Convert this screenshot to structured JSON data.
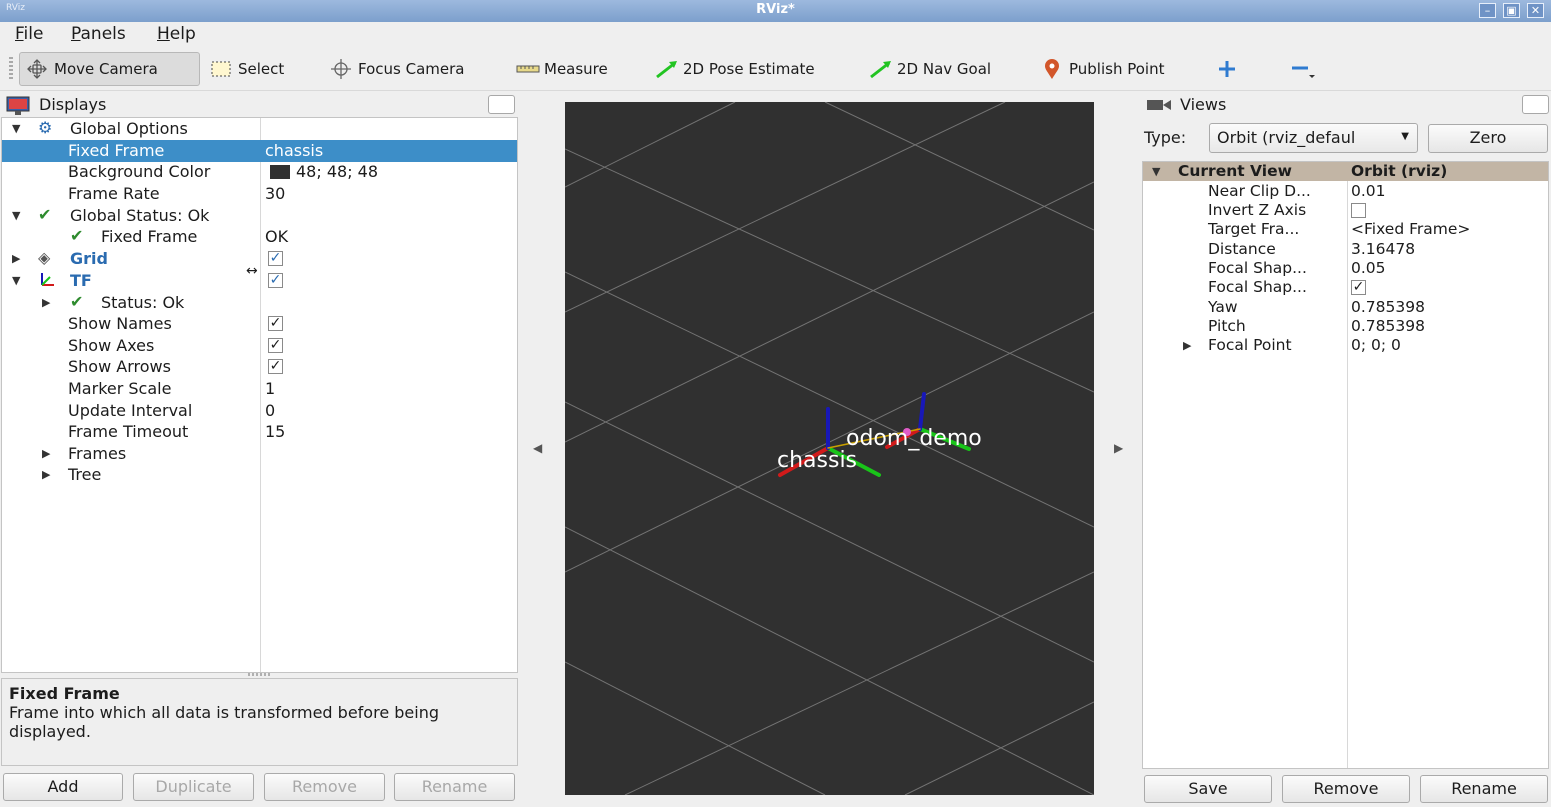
{
  "window": {
    "title": "RViz*",
    "app_icon": "RViz",
    "buttons": [
      "minimize-icon",
      "maximize-icon",
      "close-icon"
    ]
  },
  "menu": {
    "file": "File",
    "panels": "Panels",
    "help": "Help"
  },
  "toolbar": {
    "move_camera": "Move Camera",
    "select": "Select",
    "focus_camera": "Focus Camera",
    "measure": "Measure",
    "pose_estimate": "2D Pose Estimate",
    "nav_goal": "2D Nav Goal",
    "publish_point": "Publish Point",
    "add_tool_icon": "plus-icon",
    "remove_tool_icon": "minus-icon",
    "colors": {
      "nav_arrow": "#22c422",
      "publish_pin": "#d2562a",
      "plus": "#2f7bd0"
    }
  },
  "displays": {
    "title": "Displays",
    "rows": {
      "global_options": "Global Options",
      "fixed_frame_label": "Fixed Frame",
      "fixed_frame_value": "chassis",
      "background_color_label": "Background Color",
      "background_color_value": "48; 48; 48",
      "frame_rate_label": "Frame Rate",
      "frame_rate_value": "30",
      "global_status": "Global Status: Ok",
      "gs_fixed_frame": "Fixed Frame",
      "gs_fixed_frame_value": "OK",
      "grid": "Grid",
      "tf": "TF",
      "tf_status": "Status: Ok",
      "show_names": "Show Names",
      "show_axes": "Show Axes",
      "show_arrows": "Show Arrows",
      "marker_scale": "Marker Scale",
      "marker_scale_value": "1",
      "update_interval": "Update Interval",
      "update_interval_value": "0",
      "frame_timeout": "Frame Timeout",
      "frame_timeout_value": "15",
      "frames": "Frames",
      "tree": "Tree"
    },
    "checked": {
      "grid": true,
      "tf": true,
      "show_names": true,
      "show_axes": true,
      "show_arrows": true
    },
    "help_title": "Fixed Frame",
    "help_text": "Frame into which all data is transformed before being displayed.",
    "buttons": {
      "add": "Add",
      "duplicate": "Duplicate",
      "remove": "Remove",
      "rename": "Rename"
    },
    "colors": {
      "selection": "#3d8ec8",
      "bg_swatch": "#303030",
      "link": "#2a6bb0",
      "ok": "#2e8b2e"
    }
  },
  "viewport": {
    "background": "#303030",
    "labels": {
      "chassis": "chassis",
      "odom": "odom_demo"
    },
    "axis_colors": {
      "x": "#d11a1a",
      "y": "#19c419",
      "z": "#1818b8"
    }
  },
  "views": {
    "title": "Views",
    "type_label": "Type:",
    "type_value": "Orbit (rviz_defaul",
    "zero_button": "Zero",
    "header_name": "Current View",
    "header_value": "Orbit (rviz)",
    "rows": [
      {
        "name": "Near Clip D...",
        "value": "0.01"
      },
      {
        "name": "Invert Z Axis",
        "value": ""
      },
      {
        "name": "Target Fra...",
        "value": "<Fixed Frame>"
      },
      {
        "name": "Distance",
        "value": "3.16478"
      },
      {
        "name": "Focal Shap...",
        "value": "0.05"
      },
      {
        "name": "Focal Shap...",
        "value": ""
      },
      {
        "name": "Yaw",
        "value": "0.785398"
      },
      {
        "name": "Pitch",
        "value": "0.785398"
      },
      {
        "name": "Focal Point",
        "value": "0; 0; 0"
      }
    ],
    "invert_z_checked": false,
    "focal_shape_fixed_checked": true,
    "buttons": {
      "save": "Save",
      "remove": "Remove",
      "rename": "Rename"
    }
  }
}
